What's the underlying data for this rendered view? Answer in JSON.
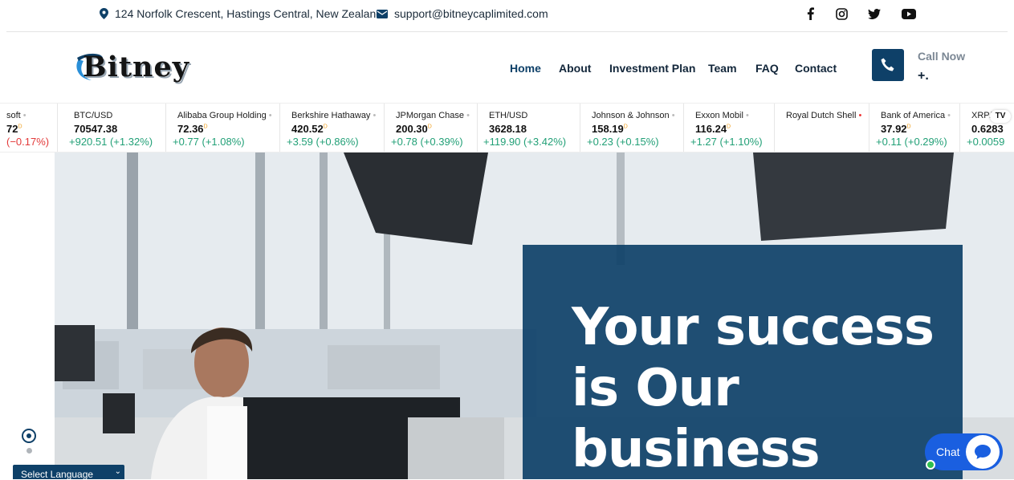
{
  "topbar": {
    "address": "124 Norfolk Crescent, Hastings Central, New Zealand",
    "email": "support@bitneycaplimited.com",
    "social": [
      "facebook-icon",
      "instagram-icon",
      "twitter-icon",
      "youtube-icon"
    ]
  },
  "header": {
    "logo_text": "Bitney",
    "nav": [
      "Home",
      "About",
      "Investment Plan",
      "Team",
      "FAQ",
      "Contact"
    ],
    "active_nav": "Home",
    "call_label": "Call Now",
    "call_number": "+."
  },
  "ticker": [
    {
      "name": "soft",
      "price": "72",
      "change": "(−0.17%)",
      "dir": "dn"
    },
    {
      "name": "BTC/USD",
      "price": "70547.38",
      "change": "+920.51 (+1.32%)",
      "dir": "up"
    },
    {
      "name": "Alibaba Group Holding",
      "price": "72.36",
      "change": "+0.77 (+1.08%)",
      "dir": "up"
    },
    {
      "name": "Berkshire Hathaway",
      "price": "420.52",
      "change": "+3.59 (+0.86%)",
      "dir": "up"
    },
    {
      "name": "JPMorgan Chase",
      "price": "200.30",
      "change": "+0.78 (+0.39%)",
      "dir": "up"
    },
    {
      "name": "ETH/USD",
      "price": "3628.18",
      "change": "+119.90 (+3.42%)",
      "dir": "up"
    },
    {
      "name": "Johnson & Johnson",
      "price": "158.19",
      "change": "+0.23 (+0.15%)",
      "dir": "up"
    },
    {
      "name": "Exxon Mobil",
      "price": "116.24",
      "change": "+1.27 (+1.10%)",
      "dir": "up"
    },
    {
      "name": "Royal Dutch Shell",
      "price": "",
      "change": "",
      "dir": "up"
    },
    {
      "name": "Bank of America",
      "price": "37.92",
      "change": "+0.11 (+0.29%)",
      "dir": "up"
    },
    {
      "name": "XRP/",
      "price": "0.6283",
      "change": "+0.0059",
      "dir": "up"
    }
  ],
  "hero": {
    "headline_lines": [
      "Your success",
      "is Our",
      "business"
    ]
  },
  "language": {
    "label": "Select Language"
  },
  "chat": {
    "label": "Chat"
  },
  "colors": {
    "brand": "#0e4068",
    "up": "#22a077",
    "down": "#e33a3a"
  }
}
